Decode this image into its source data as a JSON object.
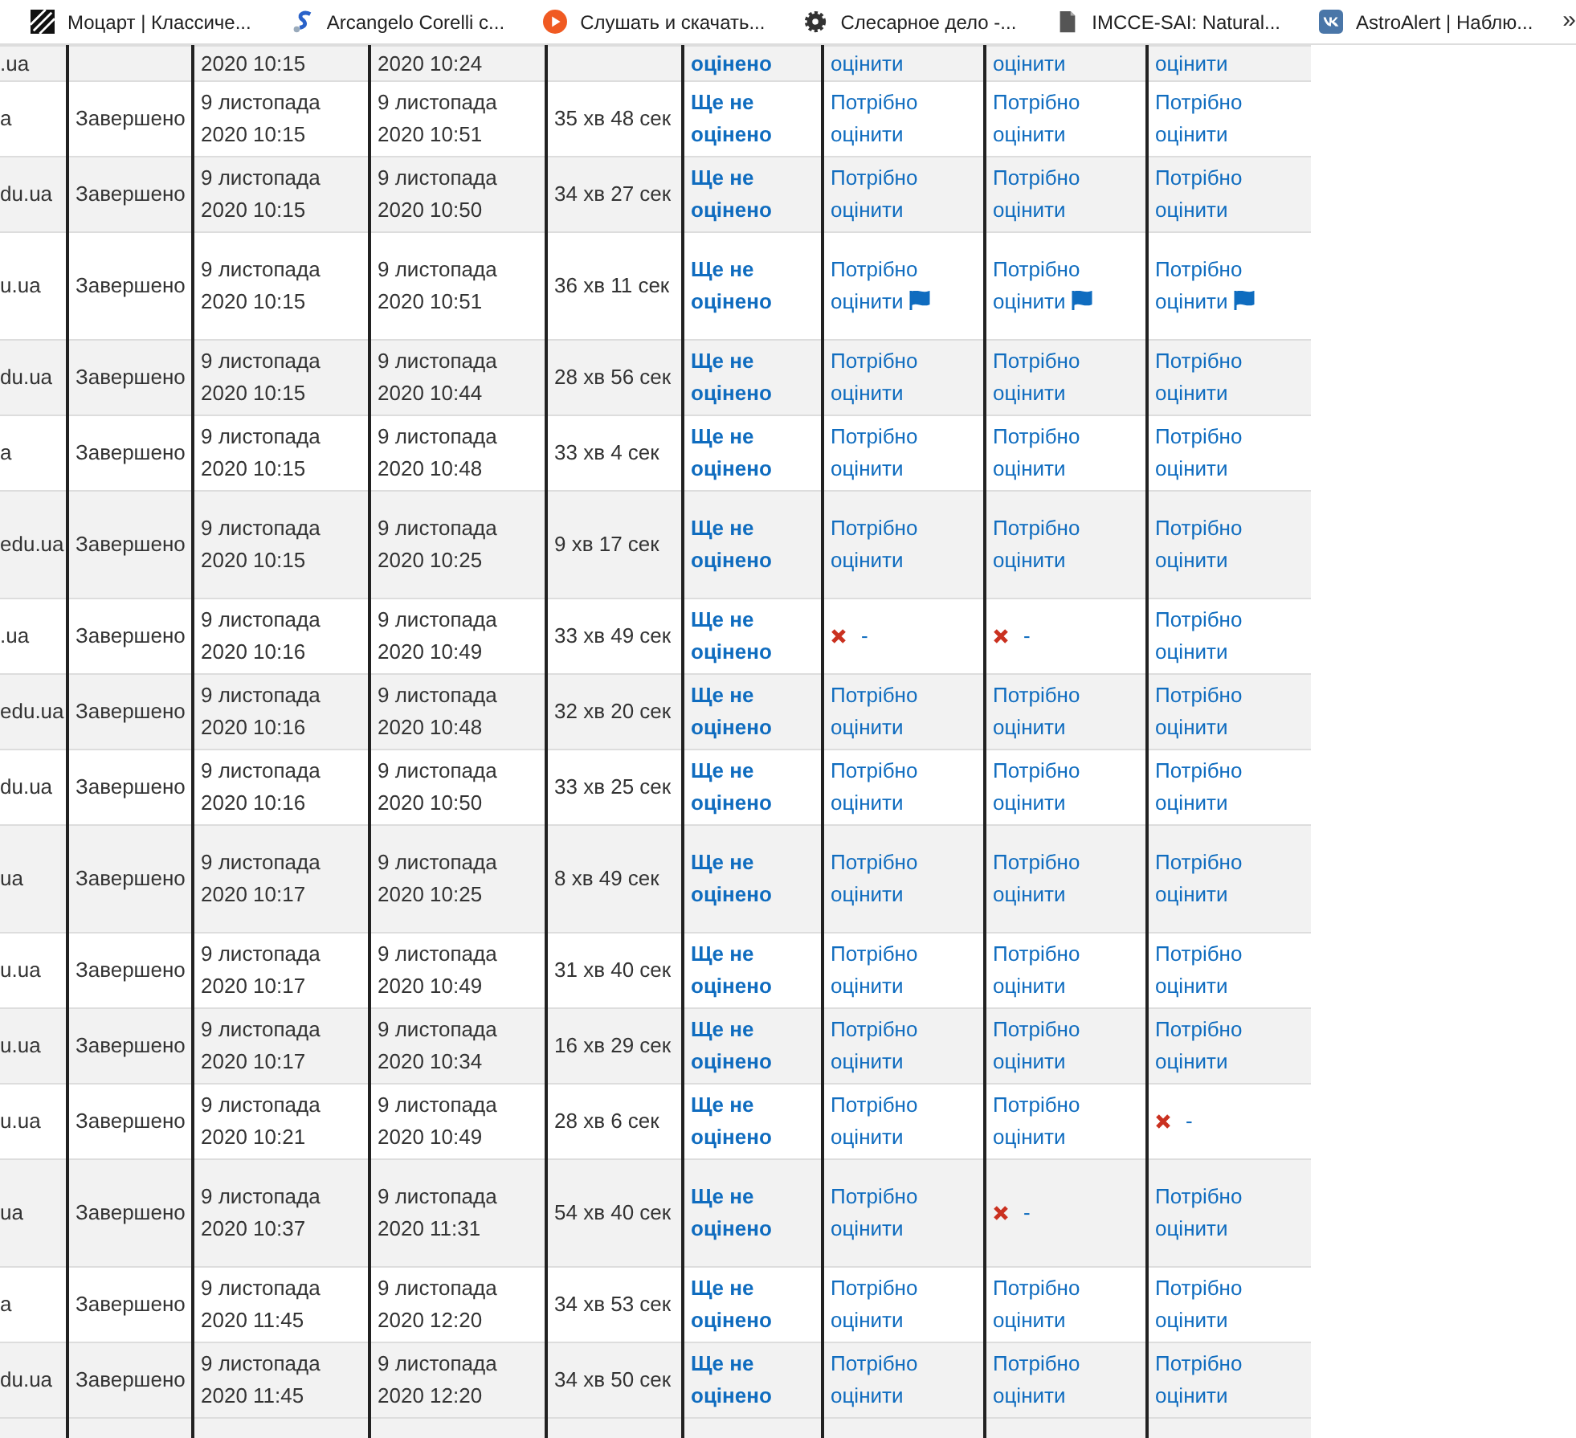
{
  "bookmarks": [
    {
      "label": "Моцарт | Классиче..."
    },
    {
      "label": "Arcangelo Corelli c..."
    },
    {
      "label": "Слушать и скачать..."
    },
    {
      "label": "Слесарное дело -..."
    },
    {
      "label": "IMCCE-SAI: Natural..."
    },
    {
      "label": "AstroAlert | Наблю..."
    }
  ],
  "more": "»",
  "top_row": {
    "email": ".ua",
    "started": "2020 10:15",
    "completed": "2020 10:24",
    "grade": "оцінено",
    "questions": [
      "оцінити",
      "оцінити",
      "оцінити"
    ]
  },
  "rows": [
    {
      "email": "a",
      "state": "Завершено",
      "started": "9 листопада\n2020 10:15",
      "completed": "9 листопада\n2020 10:51",
      "time": "35 хв 48 сек",
      "grade": "Ще не оцінено",
      "tall": false,
      "questions": [
        {
          "kind": "link",
          "text": "Потрібно оцінити",
          "flagged": false
        },
        {
          "kind": "link",
          "text": "Потрібно оцінити",
          "flagged": false
        },
        {
          "kind": "link",
          "text": "Потрібно оцінити",
          "flagged": false
        }
      ]
    },
    {
      "email": "du.ua",
      "state": "Завершено",
      "started": "9 листопада\n2020 10:15",
      "completed": "9 листопада\n2020 10:50",
      "time": "34 хв 27 сек",
      "grade": "Ще не оцінено",
      "tall": false,
      "questions": [
        {
          "kind": "link",
          "text": "Потрібно оцінити",
          "flagged": false
        },
        {
          "kind": "link",
          "text": "Потрібно оцінити",
          "flagged": false
        },
        {
          "kind": "link",
          "text": "Потрібно оцінити",
          "flagged": false
        }
      ]
    },
    {
      "email": "u.ua",
      "state": "Завершено",
      "started": "9 листопада\n2020 10:15",
      "completed": "9 листопада\n2020 10:51",
      "time": "36 хв 11 сек",
      "grade": "Ще не оцінено",
      "tall": true,
      "questions": [
        {
          "kind": "link",
          "text": "Потрібно оцінити",
          "flagged": true
        },
        {
          "kind": "link",
          "text": "Потрібно оцінити",
          "flagged": true
        },
        {
          "kind": "link",
          "text": "Потрібно оцінити",
          "flagged": true
        }
      ]
    },
    {
      "email": "du.ua",
      "state": "Завершено",
      "started": "9 листопада\n2020 10:15",
      "completed": "9 листопада\n2020 10:44",
      "time": "28 хв 56 сек",
      "grade": "Ще не оцінено",
      "tall": false,
      "questions": [
        {
          "kind": "link",
          "text": "Потрібно оцінити",
          "flagged": false
        },
        {
          "kind": "link",
          "text": "Потрібно оцінити",
          "flagged": false
        },
        {
          "kind": "link",
          "text": "Потрібно оцінити",
          "flagged": false
        }
      ]
    },
    {
      "email": "a",
      "state": "Завершено",
      "started": "9 листопада\n2020 10:15",
      "completed": "9 листопада\n2020 10:48",
      "time": "33 хв 4 сек",
      "grade": "Ще не оцінено",
      "tall": false,
      "questions": [
        {
          "kind": "link",
          "text": "Потрібно оцінити",
          "flagged": false
        },
        {
          "kind": "link",
          "text": "Потрібно оцінити",
          "flagged": false
        },
        {
          "kind": "link",
          "text": "Потрібно оцінити",
          "flagged": false
        }
      ]
    },
    {
      "email": "edu.ua",
      "state": "Завершено",
      "started": "9 листопада\n2020 10:15",
      "completed": "9 листопада\n2020 10:25",
      "time": "9 хв 17 сек",
      "grade": "Ще не оцінено",
      "tall": true,
      "questions": [
        {
          "kind": "link",
          "text": "Потрібно оцінити",
          "flagged": false
        },
        {
          "kind": "link",
          "text": "Потрібно оцінити",
          "flagged": false
        },
        {
          "kind": "link",
          "text": "Потрібно оцінити",
          "flagged": false
        }
      ]
    },
    {
      "email": ".ua",
      "state": "Завершено",
      "started": "9 листопада\n2020 10:16",
      "completed": "9 листопада\n2020 10:49",
      "time": "33 хв 49 сек",
      "grade": "Ще не оцінено",
      "tall": false,
      "questions": [
        {
          "kind": "cross",
          "text": "-",
          "flagged": false
        },
        {
          "kind": "cross",
          "text": "-",
          "flagged": false
        },
        {
          "kind": "link",
          "text": "Потрібно оцінити",
          "flagged": false
        }
      ]
    },
    {
      "email": "edu.ua",
      "state": "Завершено",
      "started": "9 листопада\n2020 10:16",
      "completed": "9 листопада\n2020 10:48",
      "time": "32 хв 20 сек",
      "grade": "Ще не оцінено",
      "tall": false,
      "questions": [
        {
          "kind": "link",
          "text": "Потрібно оцінити",
          "flagged": false
        },
        {
          "kind": "link",
          "text": "Потрібно оцінити",
          "flagged": false
        },
        {
          "kind": "link",
          "text": "Потрібно оцінити",
          "flagged": false
        }
      ]
    },
    {
      "email": "du.ua",
      "state": "Завершено",
      "started": "9 листопада\n2020 10:16",
      "completed": "9 листопада\n2020 10:50",
      "time": "33 хв 25 сек",
      "grade": "Ще не оцінено",
      "tall": false,
      "questions": [
        {
          "kind": "link",
          "text": "Потрібно оцінити",
          "flagged": false
        },
        {
          "kind": "link",
          "text": "Потрібно оцінити",
          "flagged": false
        },
        {
          "kind": "link",
          "text": "Потрібно оцінити",
          "flagged": false
        }
      ]
    },
    {
      "email": "ua",
      "state": "Завершено",
      "started": "9 листопада\n2020 10:17",
      "completed": "9 листопада\n2020 10:25",
      "time": "8 хв 49 сек",
      "grade": "Ще не оцінено",
      "tall": true,
      "questions": [
        {
          "kind": "link",
          "text": "Потрібно оцінити",
          "flagged": false
        },
        {
          "kind": "link",
          "text": "Потрібно оцінити",
          "flagged": false
        },
        {
          "kind": "link",
          "text": "Потрібно оцінити",
          "flagged": false
        }
      ]
    },
    {
      "email": "u.ua",
      "state": "Завершено",
      "started": "9 листопада\n2020 10:17",
      "completed": "9 листопада\n2020 10:49",
      "time": "31 хв 40 сек",
      "grade": "Ще не оцінено",
      "tall": false,
      "questions": [
        {
          "kind": "link",
          "text": "Потрібно оцінити",
          "flagged": false
        },
        {
          "kind": "link",
          "text": "Потрібно оцінити",
          "flagged": false
        },
        {
          "kind": "link",
          "text": "Потрібно оцінити",
          "flagged": false
        }
      ]
    },
    {
      "email": "u.ua",
      "state": "Завершено",
      "started": "9 листопада\n2020 10:17",
      "completed": "9 листопада\n2020 10:34",
      "time": "16 хв 29 сек",
      "grade": "Ще не оцінено",
      "tall": false,
      "questions": [
        {
          "kind": "link",
          "text": "Потрібно оцінити",
          "flagged": false
        },
        {
          "kind": "link",
          "text": "Потрібно оцінити",
          "flagged": false
        },
        {
          "kind": "link",
          "text": "Потрібно оцінити",
          "flagged": false
        }
      ]
    },
    {
      "email": "u.ua",
      "state": "Завершено",
      "started": "9 листопада\n2020 10:21",
      "completed": "9 листопада\n2020 10:49",
      "time": "28 хв 6 сек",
      "grade": "Ще не оцінено",
      "tall": false,
      "questions": [
        {
          "kind": "link",
          "text": "Потрібно оцінити",
          "flagged": false
        },
        {
          "kind": "link",
          "text": "Потрібно оцінити",
          "flagged": false
        },
        {
          "kind": "cross",
          "text": "-",
          "flagged": false
        }
      ]
    },
    {
      "email": "ua",
      "state": "Завершено",
      "started": "9 листопада\n2020 10:37",
      "completed": "9 листопада\n2020 11:31",
      "time": "54 хв 40 сек",
      "grade": "Ще не оцінено",
      "tall": true,
      "questions": [
        {
          "kind": "link",
          "text": "Потрібно оцінити",
          "flagged": false
        },
        {
          "kind": "cross",
          "text": "-",
          "flagged": false
        },
        {
          "kind": "link",
          "text": "Потрібно оцінити",
          "flagged": false
        }
      ]
    },
    {
      "email": "a",
      "state": "Завершено",
      "started": "9 листопада\n2020 11:45",
      "completed": "9 листопада\n2020 12:20",
      "time": "34 хв 53 сек",
      "grade": "Ще не оцінено",
      "tall": false,
      "questions": [
        {
          "kind": "link",
          "text": "Потрібно оцінити",
          "flagged": false
        },
        {
          "kind": "link",
          "text": "Потрібно оцінити",
          "flagged": false
        },
        {
          "kind": "link",
          "text": "Потрібно оцінити",
          "flagged": false
        }
      ]
    },
    {
      "email": "du.ua",
      "state": "Завершено",
      "started": "9 листопада\n2020 11:45",
      "completed": "9 листопада\n2020 12:20",
      "time": "34 хв 50 сек",
      "grade": "Ще не оцінено",
      "tall": false,
      "questions": [
        {
          "kind": "link",
          "text": "Потрібно оцінити",
          "flagged": false
        },
        {
          "kind": "link",
          "text": "Потрібно оцінити",
          "flagged": false
        },
        {
          "kind": "link",
          "text": "Потрібно оцінити",
          "flagged": false
        }
      ]
    }
  ]
}
